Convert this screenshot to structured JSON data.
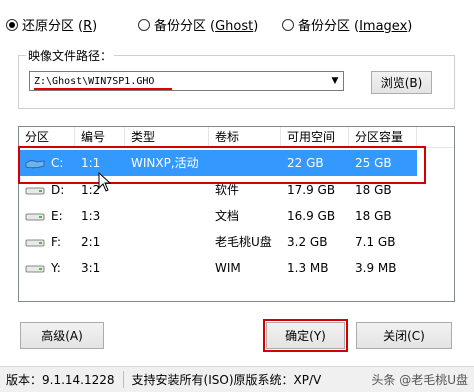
{
  "radios": [
    {
      "label": "还原分区",
      "key": "R",
      "checked": true
    },
    {
      "label": "备份分区",
      "key_prefix": "(",
      "key": "Ghost",
      "checked": false
    },
    {
      "label": "备份分区",
      "key_prefix": "(",
      "key": "Imagex",
      "checked": false
    }
  ],
  "image_path": {
    "title": "映像文件路径：",
    "value": "Z:\\Ghost\\WIN7SP1.GHO",
    "browse_label": "浏览(B)"
  },
  "table": {
    "headers": [
      "分区",
      "编号",
      "类型",
      "卷标",
      "可用空间",
      "分区容量"
    ],
    "rows": [
      {
        "drive": "C:",
        "num": "1:1",
        "type": "WINXP,活动",
        "label": "",
        "free": "22 GB",
        "size": "25 GB",
        "selected": true
      },
      {
        "drive": "D:",
        "num": "1:2",
        "type": "",
        "label": "软件",
        "free": "17.9 GB",
        "size": "18 GB",
        "selected": false
      },
      {
        "drive": "E:",
        "num": "1:3",
        "type": "",
        "label": "文档",
        "free": "16.9 GB",
        "size": "18 GB",
        "selected": false
      },
      {
        "drive": "F:",
        "num": "2:1",
        "type": "",
        "label": "老毛桃U盘",
        "free": "3.2 GB",
        "size": "7.1 GB",
        "selected": false
      },
      {
        "drive": "Y:",
        "num": "3:1",
        "type": "",
        "label": "WIM",
        "free": "1.3 MB",
        "size": "3.9 MB",
        "selected": false
      }
    ]
  },
  "buttons": {
    "advanced": "高级(A)",
    "confirm": "确定(Y)",
    "close": "关闭(C)"
  },
  "status": {
    "version": "版本：9.1.14.1228",
    "support": "支持安装所有(ISO)原版系统：XP/V",
    "watermark": "头条 @老毛桃U盘"
  },
  "colors": {
    "selection": "#3399ff",
    "highlight": "#d30000"
  }
}
